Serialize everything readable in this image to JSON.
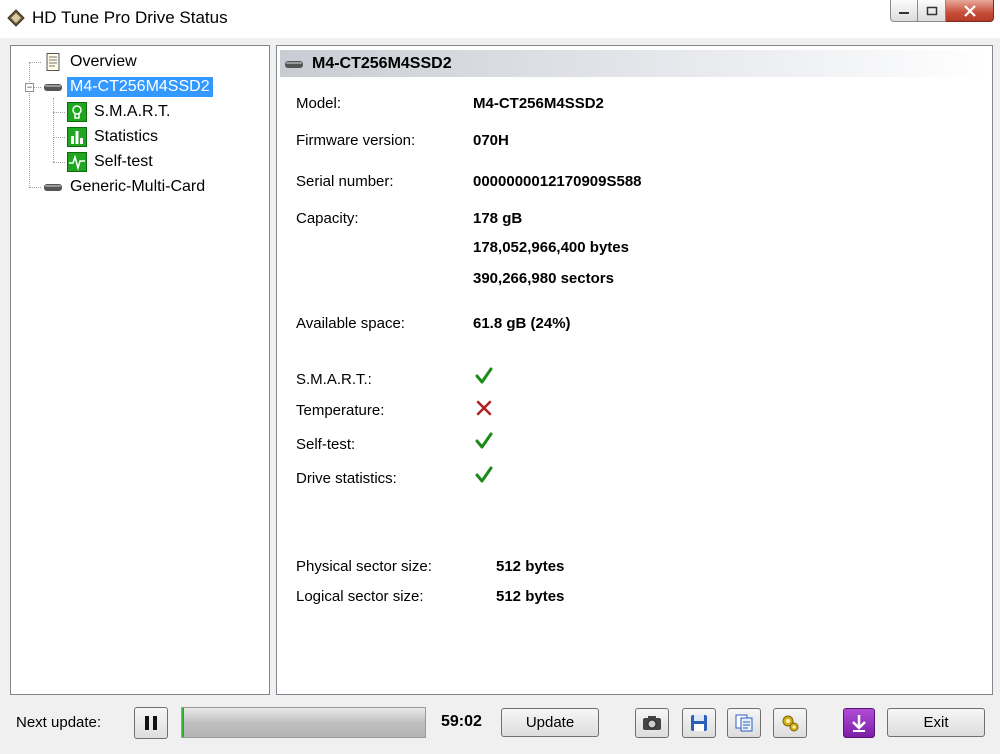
{
  "window": {
    "title": "HD Tune Pro Drive Status",
    "icon": "hdtune-diamond-icon"
  },
  "tree": {
    "items": [
      {
        "label": "Overview",
        "icon": "document-icon"
      },
      {
        "label": "M4-CT256M4SSD2",
        "icon": "drive-icon",
        "selected": true
      },
      {
        "label": "S.M.A.R.T.",
        "icon": "lightbulb-icon"
      },
      {
        "label": "Statistics",
        "icon": "bar-chart-icon"
      },
      {
        "label": "Self-test",
        "icon": "pulse-icon"
      },
      {
        "label": "Generic-Multi-Card",
        "icon": "drive-icon"
      }
    ]
  },
  "detail": {
    "header": "M4-CT256M4SSD2",
    "model_label": "Model:",
    "model_value": "M4-CT256M4SSD2",
    "firmware_label": "Firmware version:",
    "firmware_value": "070H",
    "serial_label": "Serial number:",
    "serial_value": "0000000012170909S588",
    "capacity_label": "Capacity:",
    "capacity_gb": "178 gB",
    "capacity_bytes": "178,052,966,400 bytes",
    "capacity_sectors": "390,266,980 sectors",
    "available_label": "Available space:",
    "available_value": "61.8 gB (24%)",
    "status": [
      {
        "label": "S.M.A.R.T.:",
        "ok": true,
        "icon": "checkmark-icon"
      },
      {
        "label": "Temperature:",
        "ok": false,
        "icon": "cross-icon"
      },
      {
        "label": "Self-test:",
        "ok": true,
        "icon": "checkmark-icon"
      },
      {
        "label": "Drive statistics:",
        "ok": true,
        "icon": "checkmark-icon"
      }
    ],
    "physical_label": "Physical sector size:",
    "physical_value": "512 bytes",
    "logical_label": "Logical sector size:",
    "logical_value": "512 bytes"
  },
  "bottom": {
    "next_update_label": "Next update:",
    "timer": "59:02",
    "progress_fraction": 0.01,
    "update_label": "Update",
    "exit_label": "Exit",
    "icons": [
      "pause-icon",
      "camera-icon",
      "save-icon",
      "copy-icon",
      "options-icon",
      "download-icon"
    ]
  },
  "colors": {
    "selection": "#3399ff",
    "ok": "#1a8a1a",
    "fail": "#b02020",
    "progress_fill": "#2db82d"
  }
}
